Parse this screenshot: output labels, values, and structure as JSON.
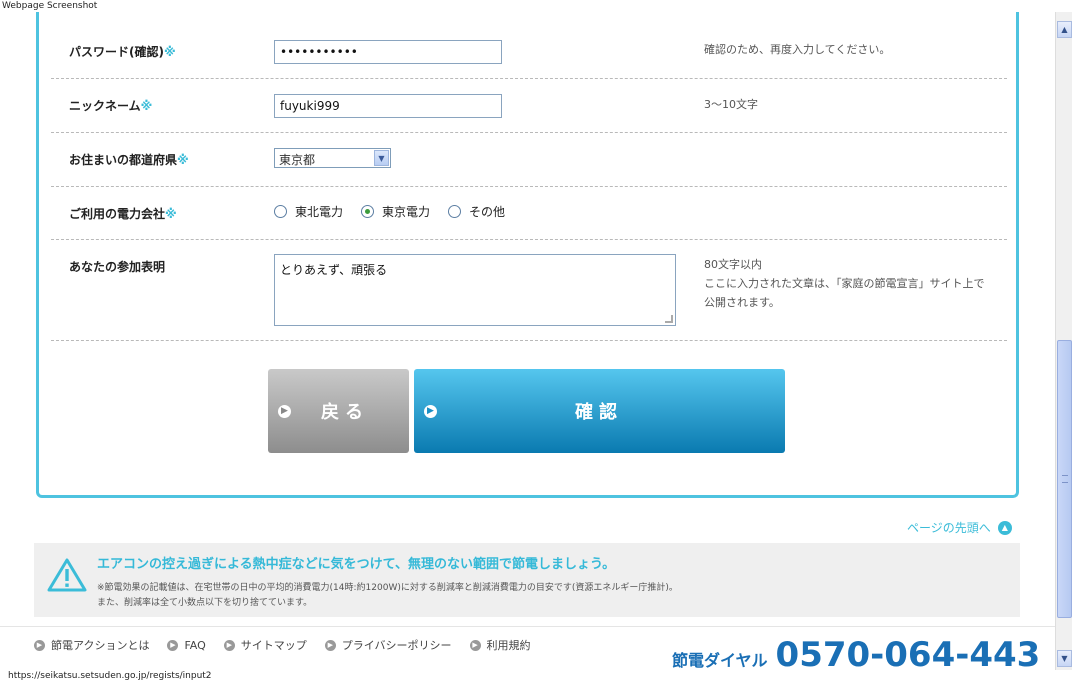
{
  "window": {
    "title": "Webpage Screenshot"
  },
  "form": {
    "password_confirm": {
      "label": "パスワード(確認)",
      "required_mark": "※",
      "value": "•••••••••••",
      "note": "確認のため、再度入力してください。"
    },
    "nickname": {
      "label": "ニックネーム",
      "required_mark": "※",
      "value": "fuyuki999",
      "note": "3〜10文字"
    },
    "prefecture": {
      "label": "お住まいの都道府県",
      "required_mark": "※",
      "selected": "東京都"
    },
    "power_company": {
      "label": "ご利用の電力会社",
      "required_mark": "※",
      "options": [
        {
          "label": "東北電力",
          "checked": false
        },
        {
          "label": "東京電力",
          "checked": true
        },
        {
          "label": "その他",
          "checked": false
        }
      ]
    },
    "statement": {
      "label": "あなたの参加表明",
      "value": "とりあえず、頑張る",
      "note_line1": "80文字以内",
      "note_line2": "ここに入力された文章は、「家庭の節電宣言」サイト上で",
      "note_line3": "公開されます。"
    }
  },
  "buttons": {
    "back": "戻る",
    "confirm": "確認"
  },
  "page_top": "ページの先頭へ",
  "notice": {
    "headline": "エアコンの控え過ぎによる熱中症などに気をつけて、無理のない範囲で節電しましょう。",
    "line1": "※節電効果の記載値は、在宅世帯の日中の平均的消費電力(14時:約1200W)に対する削減率と削減消費電力の目安です(資源エネルギー庁推計)。",
    "line2": "また、削減率は全て小数点以下を切り捨てています。"
  },
  "footer": {
    "links": [
      "節電アクションとは",
      "FAQ",
      "サイトマップ",
      "プライバシーポリシー",
      "利用規約"
    ],
    "dial_label": "節電ダイヤル",
    "dial_number": "0570-064-443"
  },
  "status": {
    "url": "https://seikatsu.setsuden.go.jp/regists/input2"
  },
  "colors": {
    "accent": "#3bbcd8",
    "confirm": "#1b8fc4",
    "border": "#4ec3e0"
  }
}
